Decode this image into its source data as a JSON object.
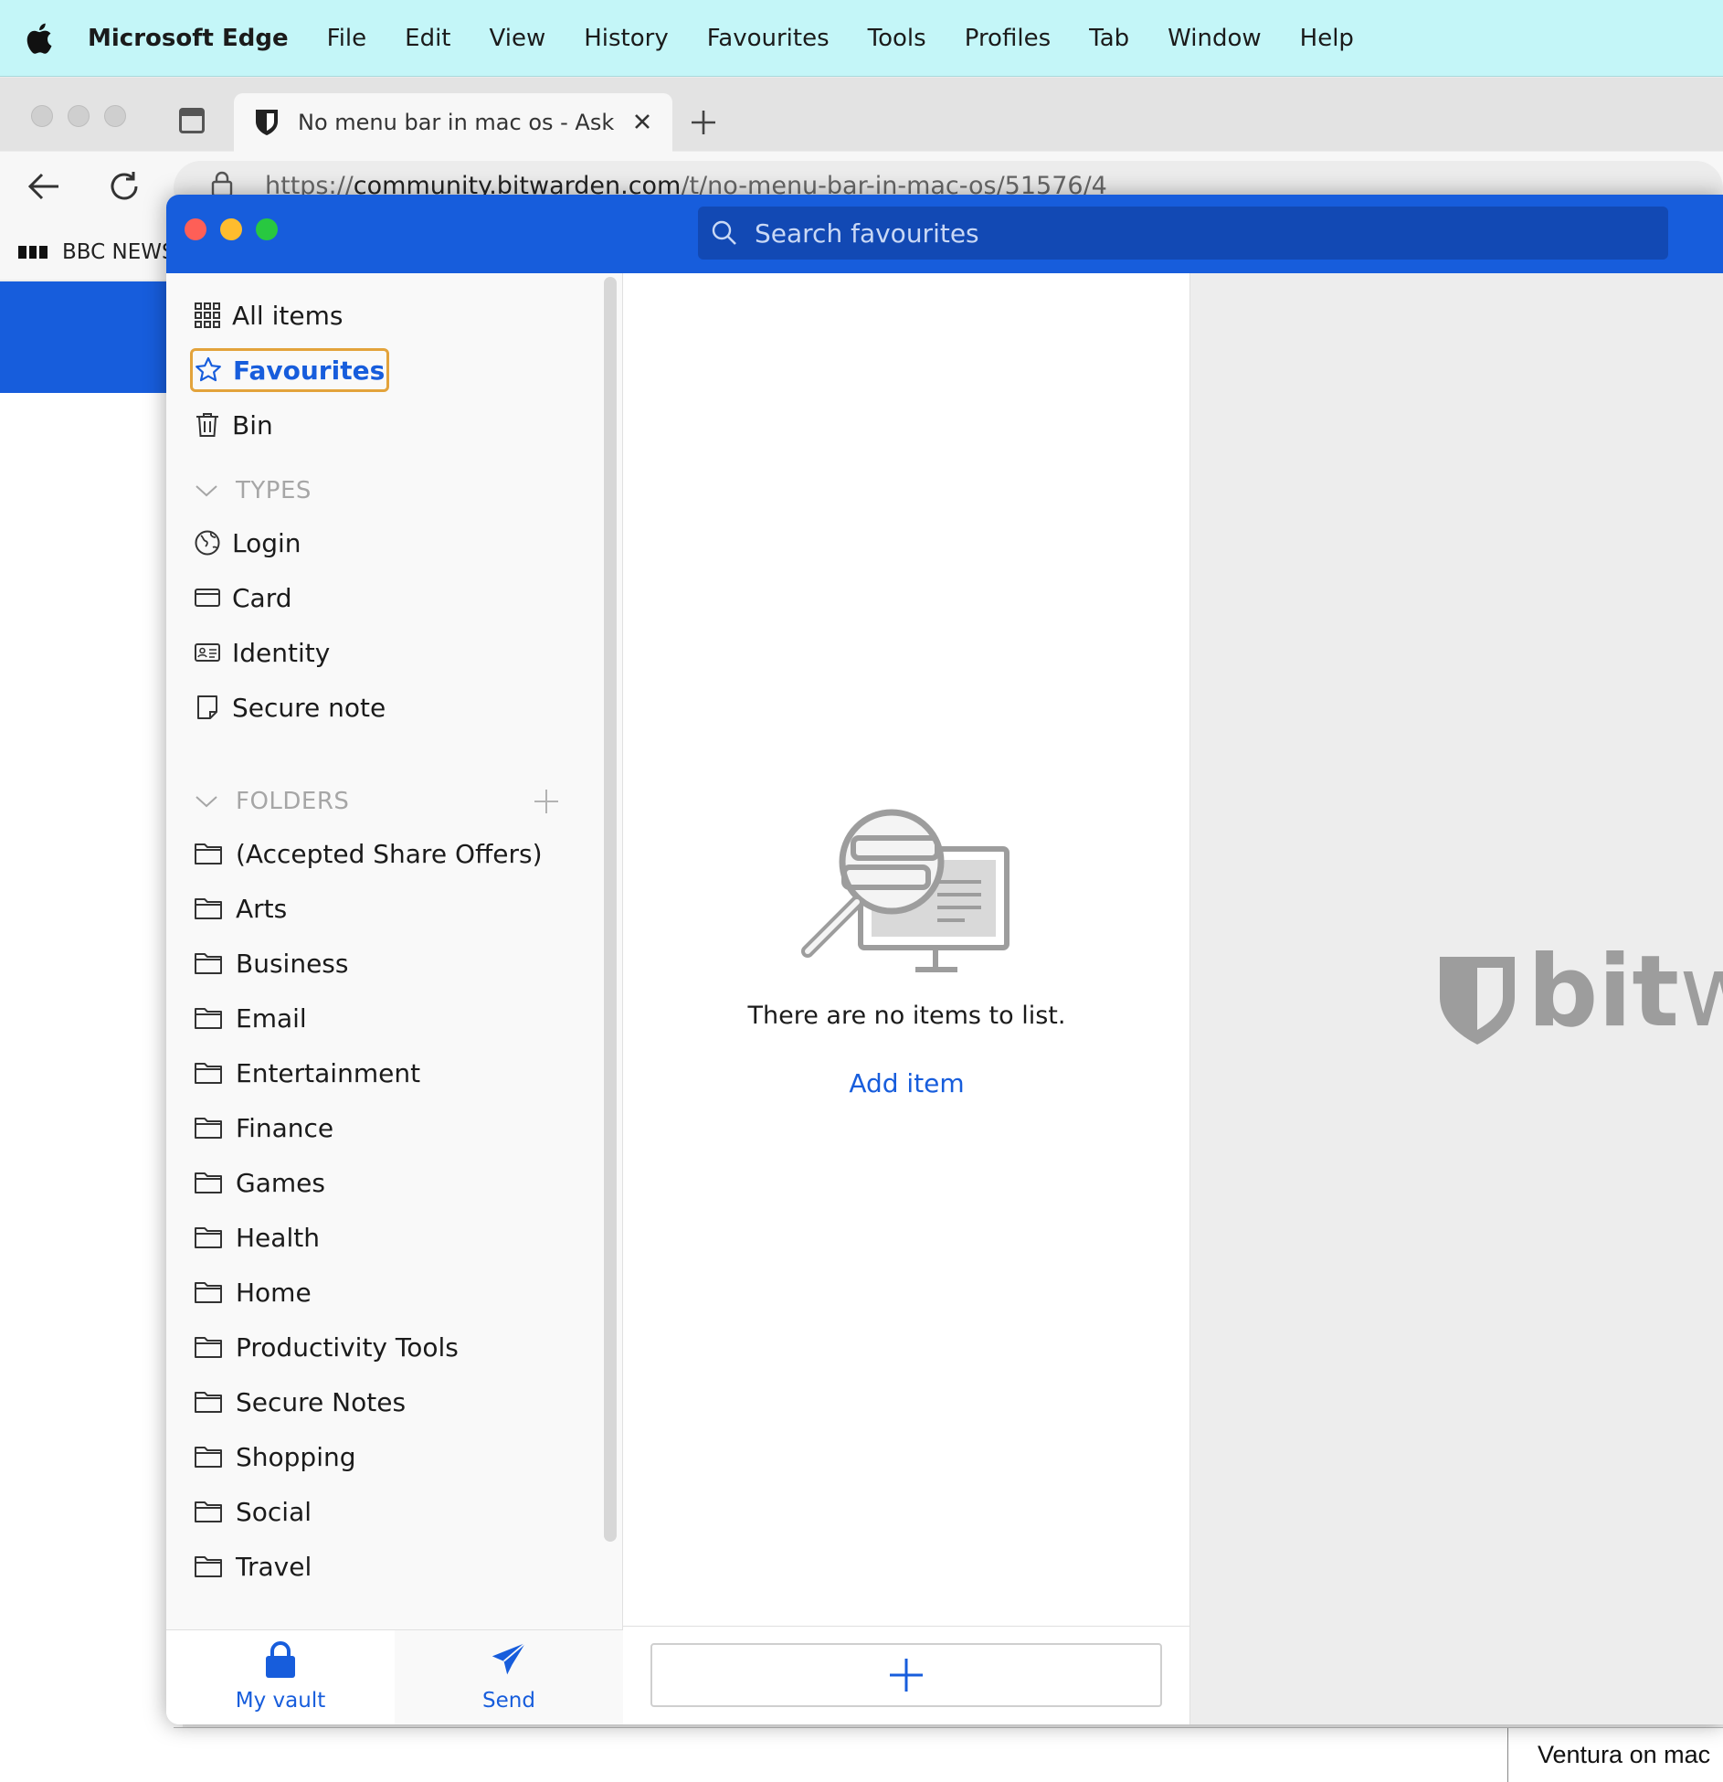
{
  "menubar": {
    "app_name": "Microsoft Edge",
    "items": [
      "File",
      "Edit",
      "View",
      "History",
      "Favourites",
      "Tools",
      "Profiles",
      "Tab",
      "Window",
      "Help"
    ]
  },
  "browser": {
    "tab_title": "No menu bar in mac os - Ask the Community",
    "url_scheme": "https://",
    "url_host": "community.bitwarden.com",
    "url_path": "/t/no-menu-bar-in-mac-os/51576/4",
    "bookmark_label": "BBC NEWS",
    "page_snippet": "Ventura on mac"
  },
  "bitwarden": {
    "search_placeholder": "Search favourites",
    "nav": {
      "all_items": "All items",
      "favourites": "Favourites",
      "bin": "Bin"
    },
    "types_heading": "TYPES",
    "types": [
      "Login",
      "Card",
      "Identity",
      "Secure note"
    ],
    "folders_heading": "FOLDERS",
    "folders": [
      "(Accepted Share Offers)",
      "Arts",
      "Business",
      "Email",
      "Entertainment",
      "Finance",
      "Games",
      "Health",
      "Home",
      "Productivity Tools",
      "Secure Notes",
      "Shopping",
      "Social",
      "Travel"
    ],
    "bottom_nav": {
      "vault": "My vault",
      "send": "Send"
    },
    "empty_text": "There are no items to list.",
    "add_item_link": "Add item",
    "logo_text_bold": "bit",
    "logo_text_thin": "w"
  },
  "colors": {
    "brand_blue": "#175ddc",
    "search_bg": "#1249b4",
    "focus_ring": "#e3a33b",
    "menubar_bg": "#c4f6f8"
  }
}
